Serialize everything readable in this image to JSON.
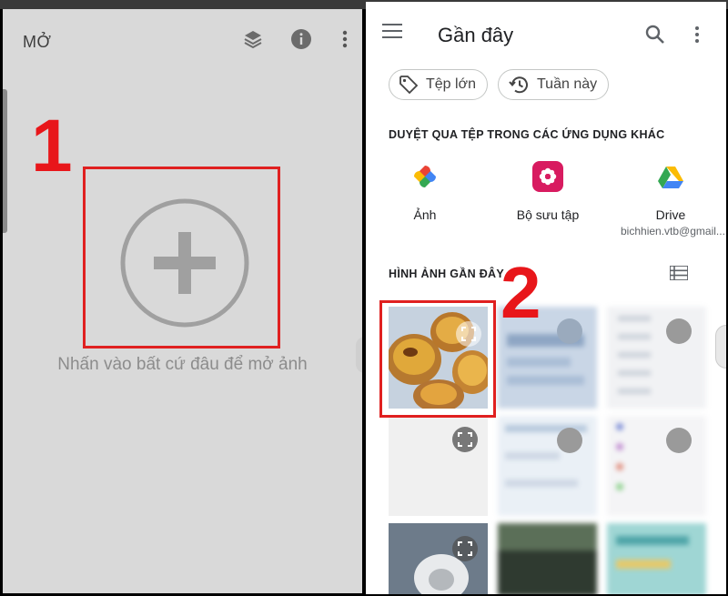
{
  "steps": {
    "one": "1",
    "two": "2"
  },
  "left_app": {
    "title": "MỞ",
    "hint": "Nhấn vào bất cứ đâu để mở ảnh",
    "icons": [
      "layers-refresh-icon",
      "info-icon",
      "more-vert-icon"
    ]
  },
  "right_app": {
    "title": "Gần đây",
    "chips": [
      "Tệp lớn",
      "Tuần này"
    ],
    "browse_section": "DUYỆT QUA TỆP TRONG CÁC ỨNG DỤNG KHÁC",
    "apps": [
      {
        "label": "Ảnh",
        "sub": ""
      },
      {
        "label": "Bộ sưu tập",
        "sub": ""
      },
      {
        "label": "Drive",
        "sub": "bichhien.vtb@gmail..."
      }
    ],
    "recent_images_section": "HÌNH ẢNH GẦN ĐÂY",
    "colors": {
      "accent_red": "#e8161a",
      "gallery_pink": "#d81b60"
    }
  }
}
